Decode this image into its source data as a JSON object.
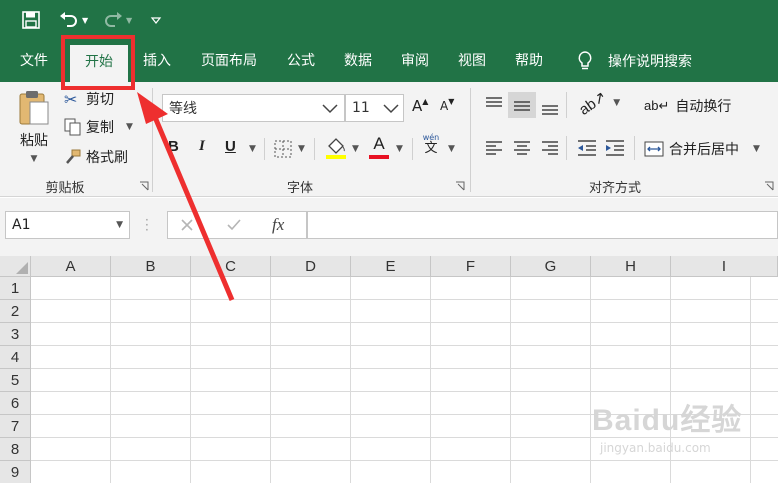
{
  "tabs": {
    "file": "文件",
    "home": "开始",
    "insert": "插入",
    "page_layout": "页面布局",
    "formulas": "公式",
    "data": "数据",
    "review": "审阅",
    "view": "视图",
    "help": "帮助",
    "tell_me": "操作说明搜索"
  },
  "clipboard": {
    "paste": "粘贴",
    "cut": "剪切",
    "copy": "复制",
    "format_painter": "格式刷",
    "group_label": "剪贴板"
  },
  "font": {
    "font_name": "等线",
    "font_size": "11",
    "grow": "A",
    "shrink": "A",
    "bold": "B",
    "italic": "I",
    "underline": "U",
    "font_color_letter": "A",
    "phonetic_top": "wén",
    "phonetic_char": "文",
    "group_label": "字体",
    "fill_color": "#ffff00",
    "text_color": "#e81123"
  },
  "alignment": {
    "wrap_text": "自动换行",
    "merge_center": "合并后居中",
    "group_label": "对齐方式"
  },
  "formula_bar": {
    "name_box": "A1",
    "fx": "fx",
    "formula": ""
  },
  "grid": {
    "columns": [
      "A",
      "B",
      "C",
      "D",
      "E",
      "F",
      "G",
      "H",
      "I"
    ],
    "rows": [
      "1",
      "2",
      "3",
      "4",
      "5",
      "6",
      "7",
      "8",
      "9"
    ]
  },
  "watermark": {
    "brand": "Baidu经验",
    "url": "jingyan.baidu.com"
  },
  "colors": {
    "brand_green": "#217346",
    "annotation_red": "#ee2f2f"
  }
}
